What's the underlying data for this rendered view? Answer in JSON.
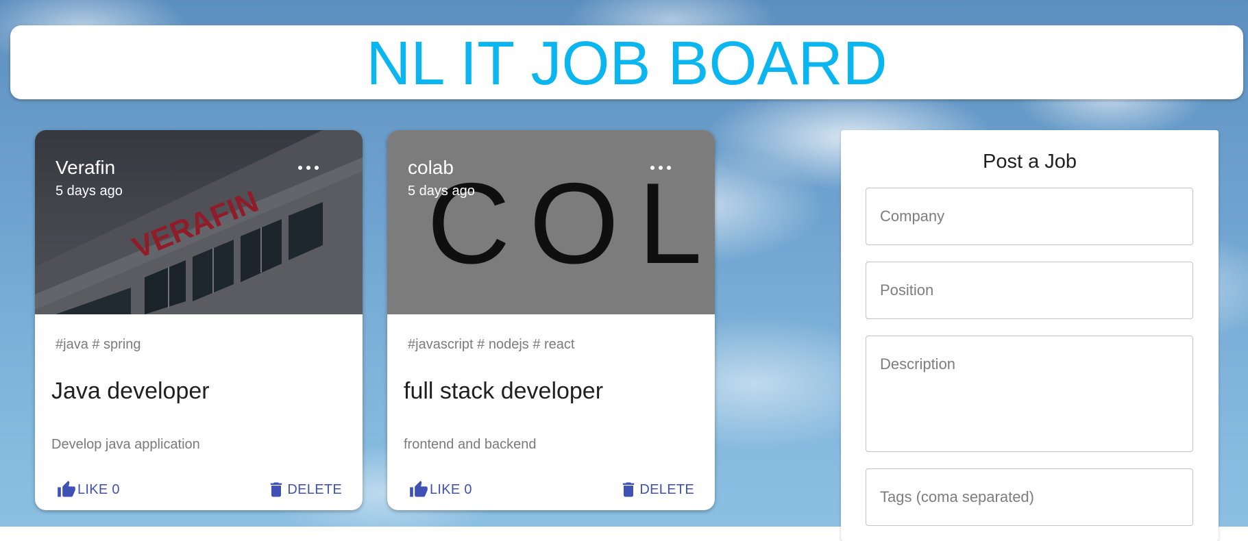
{
  "header": {
    "title": "NL IT JOB BOARD"
  },
  "posts": [
    {
      "company": "Verafin",
      "posted": "5 days ago",
      "tags": "#java # spring",
      "title": "Java developer",
      "description": "Develop java application",
      "like_label": "LIKE 0",
      "like_count": 0,
      "delete_label": "DELETE",
      "image_sign": "VERAFIN"
    },
    {
      "company": "colab",
      "posted": "5 days ago",
      "tags": "#javascript # nodejs # react",
      "title": "full stack developer",
      "description": "frontend and backend",
      "like_label": "LIKE 0",
      "like_count": 0,
      "delete_label": "DELETE",
      "image_logo": "COLAB"
    }
  ],
  "form": {
    "title": "Post a Job",
    "company_placeholder": "Company",
    "position_placeholder": "Position",
    "description_placeholder": "Description",
    "tags_placeholder": "Tags (coma separated)"
  },
  "colors": {
    "accent": "#3f51b5",
    "title_color": "#0bb6f0"
  },
  "icons": {
    "like": "thumb-up-icon",
    "delete": "trash-icon",
    "more": "more-horizontal-icon"
  }
}
